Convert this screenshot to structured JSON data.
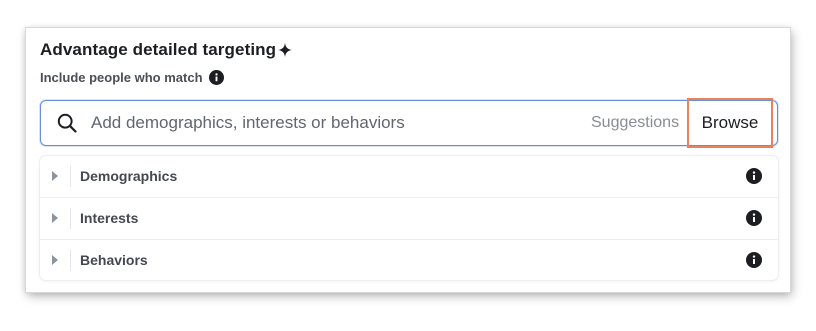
{
  "header": {
    "title": "Advantage detailed targeting",
    "subtitle": "Include people who match"
  },
  "icons": {
    "title_icon": "sparkle-icon",
    "subtitle_icon": "info-icon",
    "search_icon": "search-icon",
    "row_expand_icon": "caret-right-icon",
    "row_info_icon": "info-icon"
  },
  "search": {
    "placeholder": "Add demographics, interests or behaviors",
    "value": "",
    "suggestions_label": "Suggestions",
    "browse_label": "Browse"
  },
  "categories": [
    {
      "label": "Demographics"
    },
    {
      "label": "Interests"
    },
    {
      "label": "Behaviors"
    }
  ],
  "colors": {
    "search_border": "#6a8fd8",
    "highlight_box": "#e8825a",
    "text_primary": "#1c1e21",
    "text_muted": "#8a8d91"
  }
}
